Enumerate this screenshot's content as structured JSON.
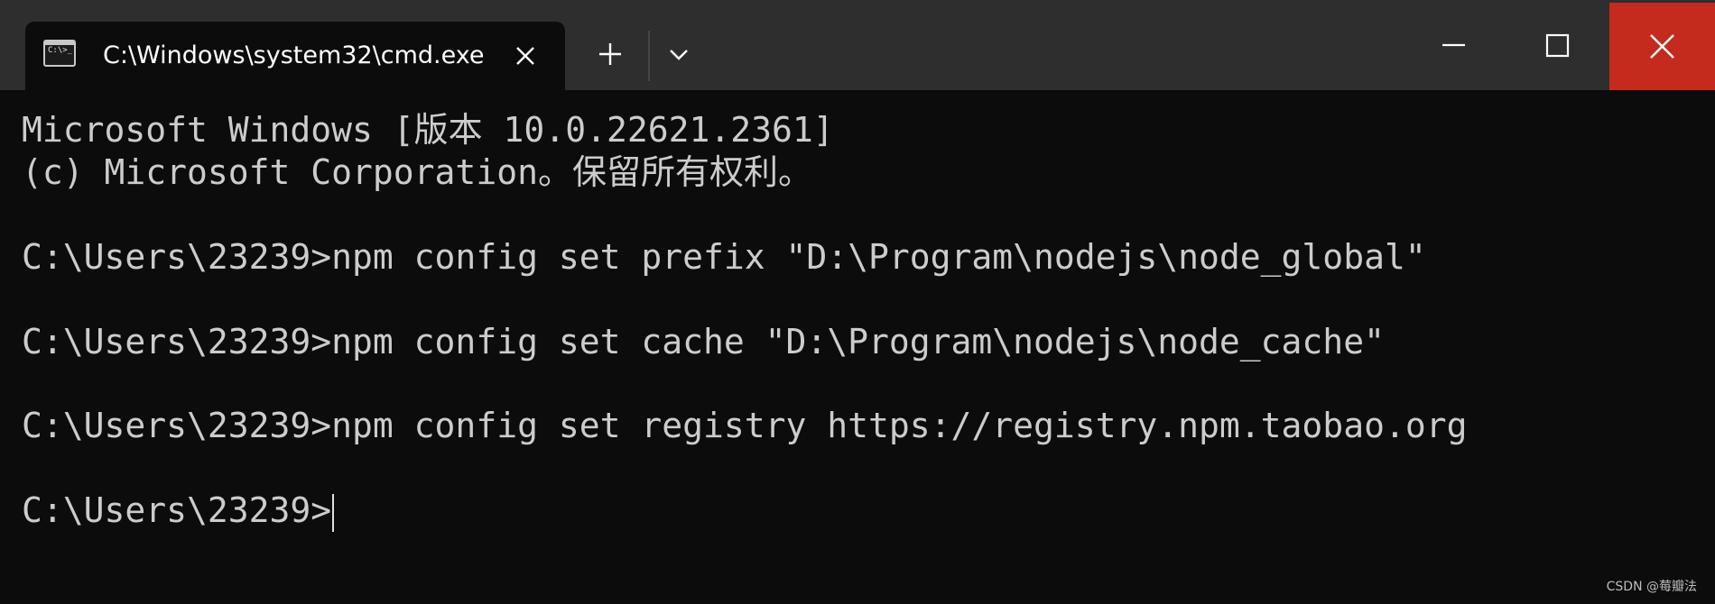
{
  "tab": {
    "icon": "cmd-icon",
    "icon_text": "C:\\>_",
    "title": "C:\\Windows\\system32\\cmd.exe"
  },
  "toolbar": {
    "new_tab_icon": "plus-icon",
    "dropdown_icon": "chevron-down-icon"
  },
  "window_controls": {
    "minimize_icon": "minimize-icon",
    "maximize_icon": "maximize-icon",
    "close_icon": "close-icon",
    "close_color": "#c42b1c"
  },
  "console": {
    "lines": [
      "Microsoft Windows [版本 10.0.22621.2361]",
      "(c) Microsoft Corporation。保留所有权利。",
      "C:\\Users\\23239>npm config set prefix \"D:\\Program\\nodejs\\node_global\"",
      "C:\\Users\\23239>npm config set cache \"D:\\Program\\nodejs\\node_cache\"",
      "C:\\Users\\23239>npm config set registry https://registry.npm.taobao.org",
      "C:\\Users\\23239>"
    ]
  },
  "watermark": "CSDN @莓瓣法"
}
